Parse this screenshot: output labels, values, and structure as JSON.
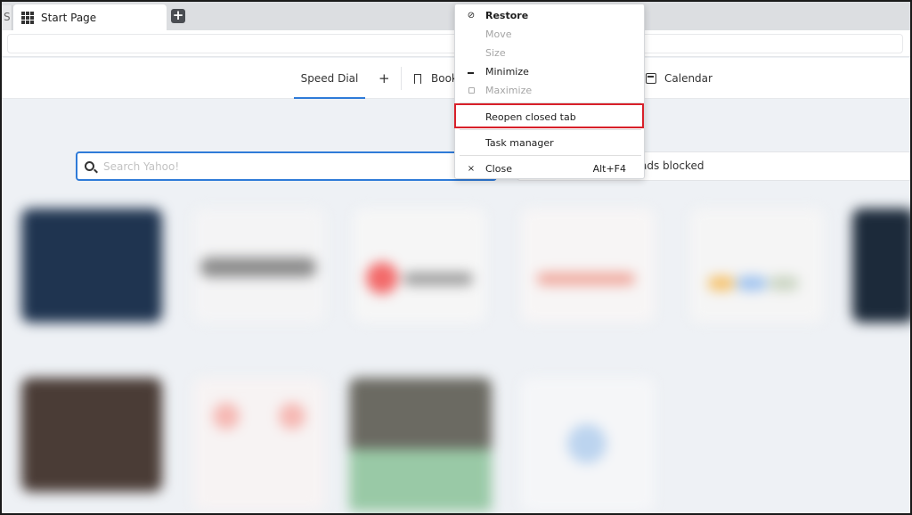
{
  "browser": {
    "edge_tab_label": "S",
    "active_tab_title": "Start Page",
    "new_tab_symbol": "+"
  },
  "start_nav": {
    "speed_dial_label": "Speed Dial",
    "add_symbol": "+",
    "bookmarks_label": "Book",
    "calendar_label": "Calendar"
  },
  "search": {
    "placeholder": "Search Yahoo!"
  },
  "adblock": {
    "text": "ads blocked"
  },
  "context_menu": {
    "items": [
      {
        "label": "Restore",
        "icon": "restore-icon",
        "enabled": true,
        "bold": true
      },
      {
        "label": "Move",
        "icon": "",
        "enabled": false
      },
      {
        "label": "Size",
        "icon": "",
        "enabled": false
      },
      {
        "label": "Minimize",
        "icon": "minimize-icon",
        "enabled": true
      },
      {
        "label": "Maximize",
        "icon": "maximize-icon",
        "enabled": false
      },
      {
        "label": "Reopen closed tab",
        "icon": "",
        "enabled": true,
        "highlighted": true
      },
      {
        "label": "Task manager",
        "icon": "",
        "enabled": true
      },
      {
        "label": "Close",
        "icon": "close-icon",
        "enabled": true,
        "shortcut": "Alt+F4"
      }
    ]
  },
  "colors": {
    "accent": "#2f7bd8",
    "highlight_box": "#d8202a"
  }
}
